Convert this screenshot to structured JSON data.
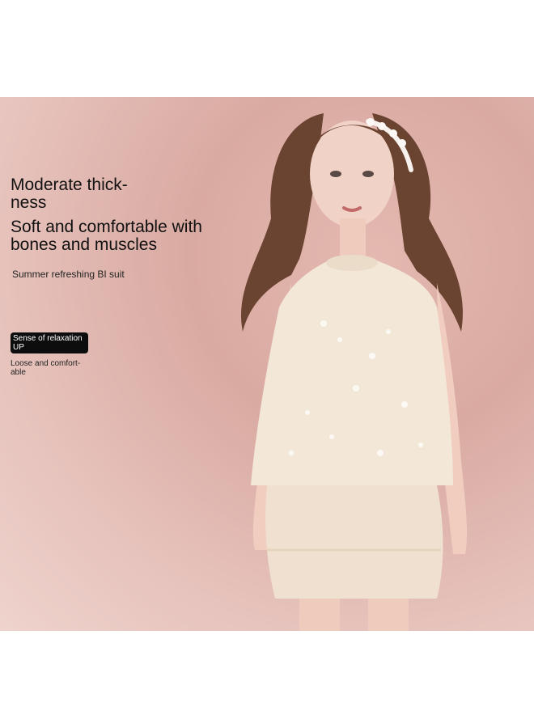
{
  "banner": {
    "headline_1": "Moderate thick-\nness",
    "headline_2": "Soft and comfortable with\nbones and muscles",
    "subtitle": "Summer refreshing BI suit",
    "tag": "Sense of relaxation\nUP",
    "tag_note": "Loose and comfort-\nable"
  },
  "colors": {
    "background": "#d9aaa2",
    "dress": "#f3e7d8",
    "hair": "#6b4331",
    "tag_bg": "#0d0d0d"
  }
}
